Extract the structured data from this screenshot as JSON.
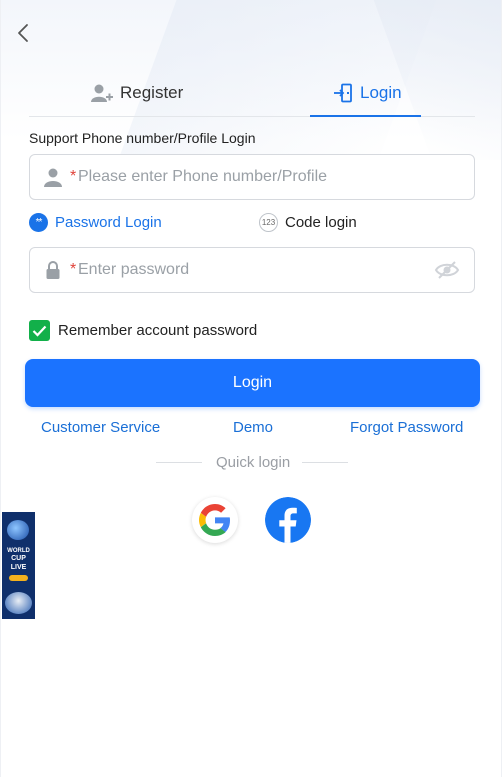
{
  "tabs": {
    "register_label": "Register",
    "login_label": "Login"
  },
  "form": {
    "hint": "Support Phone number/Profile Login",
    "phone_placeholder": "Please enter Phone number/Profile",
    "required_mark": "*",
    "password_mode_label": "Password Login",
    "password_mode_icon_text": "**",
    "code_mode_label": "Code login",
    "code_mode_icon_text": "123",
    "password_placeholder": "Enter password",
    "remember_label": "Remember account password",
    "remember_checked": true,
    "login_button": "Login"
  },
  "links": {
    "customer_service": "Customer Service",
    "demo": "Demo",
    "forgot_password": "Forgot Password"
  },
  "quick_login": {
    "label": "Quick login",
    "providers": [
      "google",
      "facebook"
    ]
  },
  "banner": {
    "line1": "WORLD",
    "line2": "CUP",
    "line3": "LIVE"
  },
  "icons": {
    "back": "chevron-left-icon",
    "register": "user-add-icon",
    "login": "login-door-icon",
    "phone_field": "user-icon",
    "password_field": "lock-icon",
    "visibility": "eye-off-icon"
  },
  "colors": {
    "accent": "#1a73e8",
    "login_button": "#1b73ff",
    "checkbox": "#12b04a",
    "required": "#e0433a",
    "facebook": "#1877f2"
  }
}
